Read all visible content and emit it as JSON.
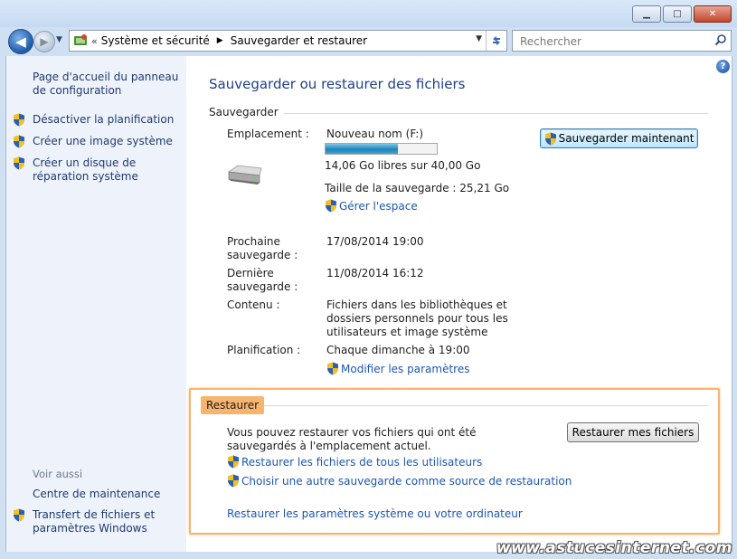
{
  "window": {
    "minimize": "▁",
    "maximize": "□",
    "close": "✕"
  },
  "nav": {
    "back": "◀",
    "forward": "▶",
    "overflow": "«",
    "breadcrumbs": [
      "Système et sécurité",
      "Sauvegarder et restaurer"
    ],
    "search_placeholder": "Rechercher"
  },
  "sidebar": {
    "home_link": "Page d'accueil du panneau de configuration",
    "tasks": [
      "Désactiver la planification",
      "Créer une image système",
      "Créer un disque de réparation système"
    ],
    "see_also_heading": "Voir aussi",
    "see_also": [
      "Centre de maintenance",
      "Transfert de fichiers et paramètres Windows"
    ]
  },
  "main": {
    "title": "Sauvegarder ou restaurer des fichiers",
    "help": "?",
    "backup": {
      "section": "Sauvegarder",
      "location_label": "Emplacement :",
      "drive_name": "Nouveau nom (F:)",
      "drive_used_fraction": 0.65,
      "free_space": "14,06 Go libres sur 40,00 Go",
      "backup_size": "Taille de la sauvegarde : 25,21 Go",
      "manage_space": "Gérer l'espace",
      "backup_now": "Sauvegarder maintenant",
      "next_label": "Prochaine sauvegarde :",
      "next_value": "17/08/2014 19:00",
      "last_label": "Dernière sauvegarde :",
      "last_value": "11/08/2014 16:12",
      "contents_label": "Contenu :",
      "contents_value": "Fichiers dans les bibliothèques et dossiers personnels pour tous les utilisateurs et image système",
      "schedule_label": "Planification :",
      "schedule_value": "Chaque dimanche à 19:00",
      "change_settings": "Modifier les paramètres"
    },
    "restore": {
      "section": "Restaurer",
      "description": "Vous pouvez restaurer vos fichiers qui ont été sauvegardés à l'emplacement actuel.",
      "restore_my_files": "Restaurer mes fichiers",
      "restore_all_users": "Restaurer les fichiers de tous les utilisateurs",
      "choose_other": "Choisir une autre sauvegarde comme source de restauration",
      "restore_system": "Restaurer les paramètres système ou votre ordinateur"
    }
  },
  "watermark": "www.astucesinternet.com",
  "colors": {
    "link": "#1c56b5",
    "title": "#1e3f8a",
    "highlight": "#f5b473"
  }
}
